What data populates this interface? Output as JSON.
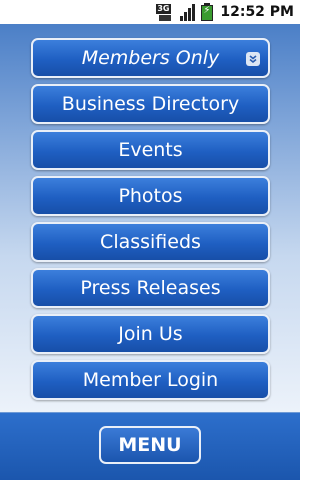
{
  "status_bar": {
    "network_label": "3G",
    "time": "12:52 PM"
  },
  "nav": {
    "items": [
      {
        "label": "Members Only",
        "icon": "chevron-down-icon"
      },
      {
        "label": "Business Directory"
      },
      {
        "label": "Events"
      },
      {
        "label": "Photos"
      },
      {
        "label": "Classifieds"
      },
      {
        "label": "Press Releases"
      },
      {
        "label": "Join Us"
      },
      {
        "label": "Member Login"
      }
    ]
  },
  "bottom_bar": {
    "menu_label": "MENU"
  },
  "colors": {
    "button_blue": "#1f5fc2",
    "button_border": "#e9eff8",
    "background_top": "#4b7fc7",
    "background_bottom": "#ecf2fa",
    "bar_blue": "#1b56ad"
  }
}
